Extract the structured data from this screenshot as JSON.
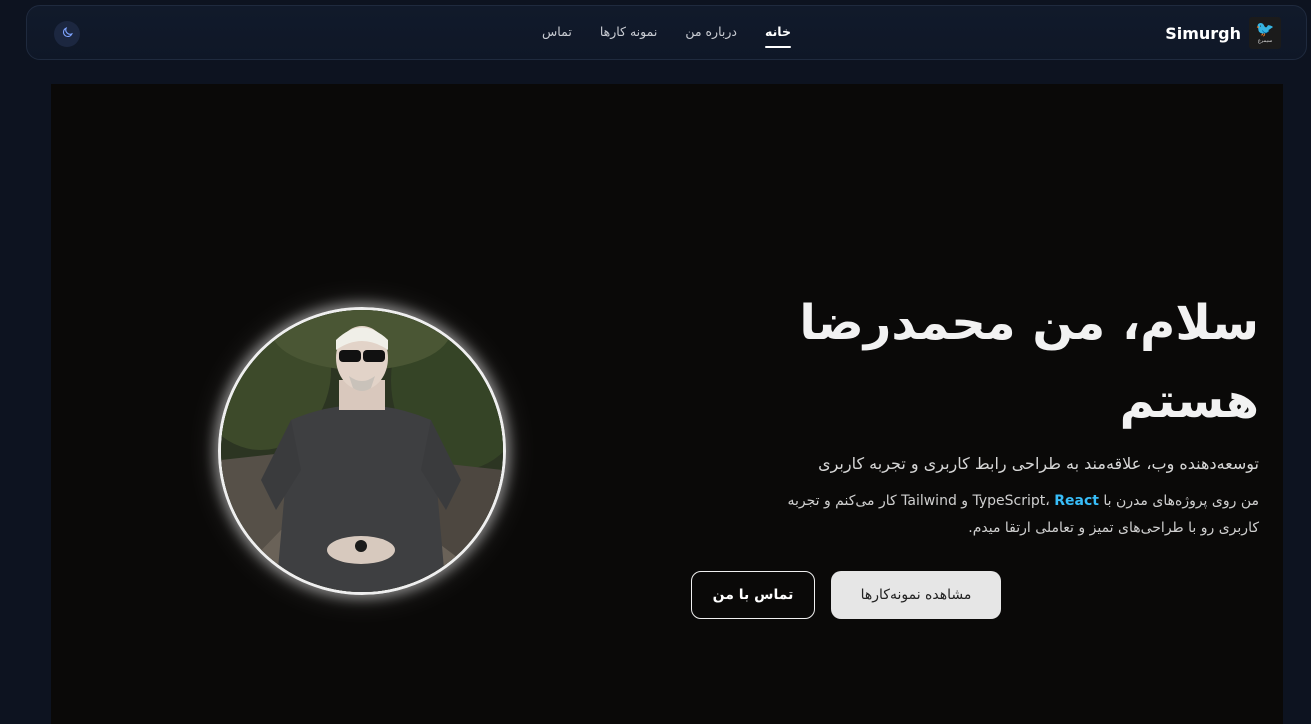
{
  "navbar": {
    "brand_name": "Simurgh",
    "logo_caption": "سیمرغ",
    "theme_icon": "moon-icon",
    "links": [
      {
        "label": "خانه",
        "active": true
      },
      {
        "label": "درباره من",
        "active": false
      },
      {
        "label": "نمونه کارها",
        "active": false
      },
      {
        "label": "تماس",
        "active": false
      }
    ]
  },
  "hero": {
    "title_line1": "سلام، من محمدرضا",
    "title_line2": "هستم",
    "subtitle": "توسعه‌دهنده وب، علاقه‌مند به طراحی رابط کاربری و تجربه کاربری",
    "description": {
      "part1": "من روی پروژه‌های مدرن با TypeScript، ",
      "highlight": "React",
      "part2": " و Tailwind کار می‌کنم و تجربه کاربری رو با طراحی‌های تمیز و تعاملی ارتقا میدم."
    },
    "primary_button": "مشاهده نمونه‌کارها",
    "secondary_button": "تماس با من",
    "accent_color": "#38bdf8"
  }
}
